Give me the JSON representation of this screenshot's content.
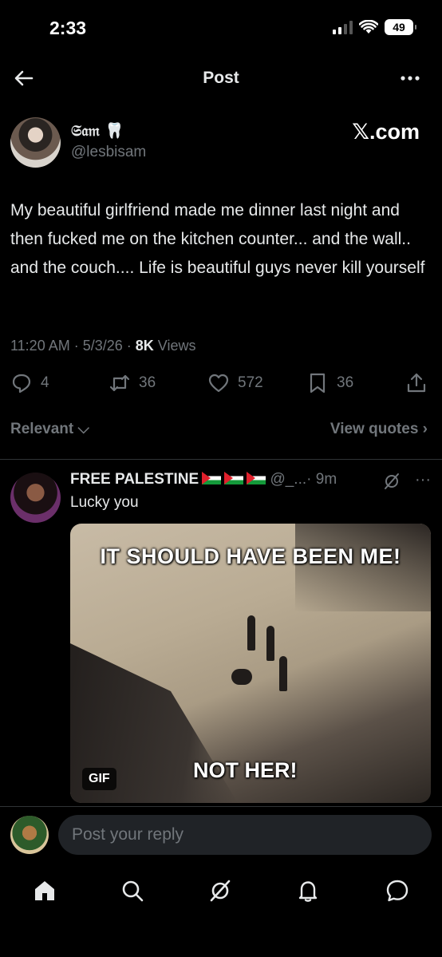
{
  "status_bar": {
    "time": "2:33",
    "battery": "49"
  },
  "nav": {
    "title": "Post"
  },
  "post": {
    "display_name": "𝔖𝔞𝔪 🦷",
    "handle": "@lesbisam",
    "watermark": "𝕏.com",
    "text": "My beautiful girlfriend made me dinner last night and then fucked me on the kitchen counter... and the wall.. and the couch.... Life is beautiful guys never kill yourself",
    "time": "11:20 AM · 5/3/26 · ",
    "views_count": "8K",
    "views_label": " Views",
    "replies": "4",
    "reposts": "36",
    "likes": "572",
    "bookmarks": "36"
  },
  "sort": {
    "left": "Relevant ⌵",
    "right": "View quotes ›"
  },
  "reply": {
    "name": "FREE PALESTINE",
    "handle": "@_...",
    "time": "· 9m",
    "text": "Lucky you",
    "gif_top": "IT SHOULD HAVE BEEN ME!",
    "gif_bottom": "NOT HER!",
    "gif_badge": "GIF"
  },
  "composer": {
    "placeholder": "Post your reply"
  },
  "icons": {
    "back": "arrow-left-icon",
    "more": "more-icon",
    "reply": "speech-bubble-icon",
    "repost": "repost-icon",
    "like": "heart-icon",
    "bookmark": "bookmark-icon",
    "share": "share-icon",
    "grok": "grok-icon",
    "home": "home-icon",
    "search": "search-icon",
    "notifications": "bell-icon",
    "messages": "message-icon"
  },
  "colors": {
    "background": "#000000",
    "text": "#e7e9ea",
    "muted": "#71767b",
    "composer": "#202327"
  }
}
